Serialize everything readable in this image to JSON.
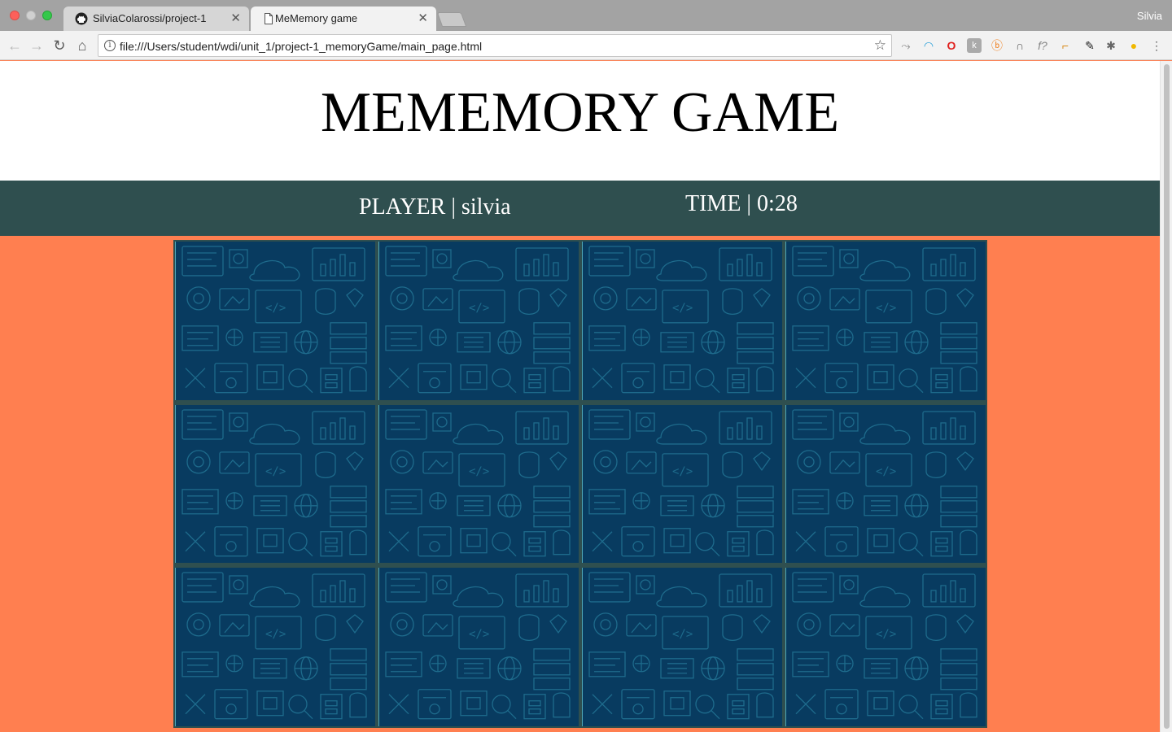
{
  "browser": {
    "tabs": [
      {
        "title": "SilviaColarossi/project-1",
        "active": false,
        "icon": "github-icon"
      },
      {
        "title": "MeMemory game",
        "active": true,
        "icon": "page-icon"
      }
    ],
    "profile_name": "Silvia",
    "url": "file:///Users/student/wdi/unit_1/project-1_memoryGame/main_page.html"
  },
  "page": {
    "title": "MEMEMORY GAME",
    "player_label": "PLAYER | silvia",
    "time_label": "TIME | 0:28"
  },
  "board": {
    "rows": 3,
    "cols": 4,
    "cards": 12,
    "card_back": "tech-pattern",
    "colors": {
      "card": "#083b60",
      "pattern": "#1e6b8c",
      "board": "#2f4f4f"
    }
  },
  "colors": {
    "background": "#ff7f50",
    "status_bar": "#2f4f4f",
    "header": "#ffffff"
  }
}
